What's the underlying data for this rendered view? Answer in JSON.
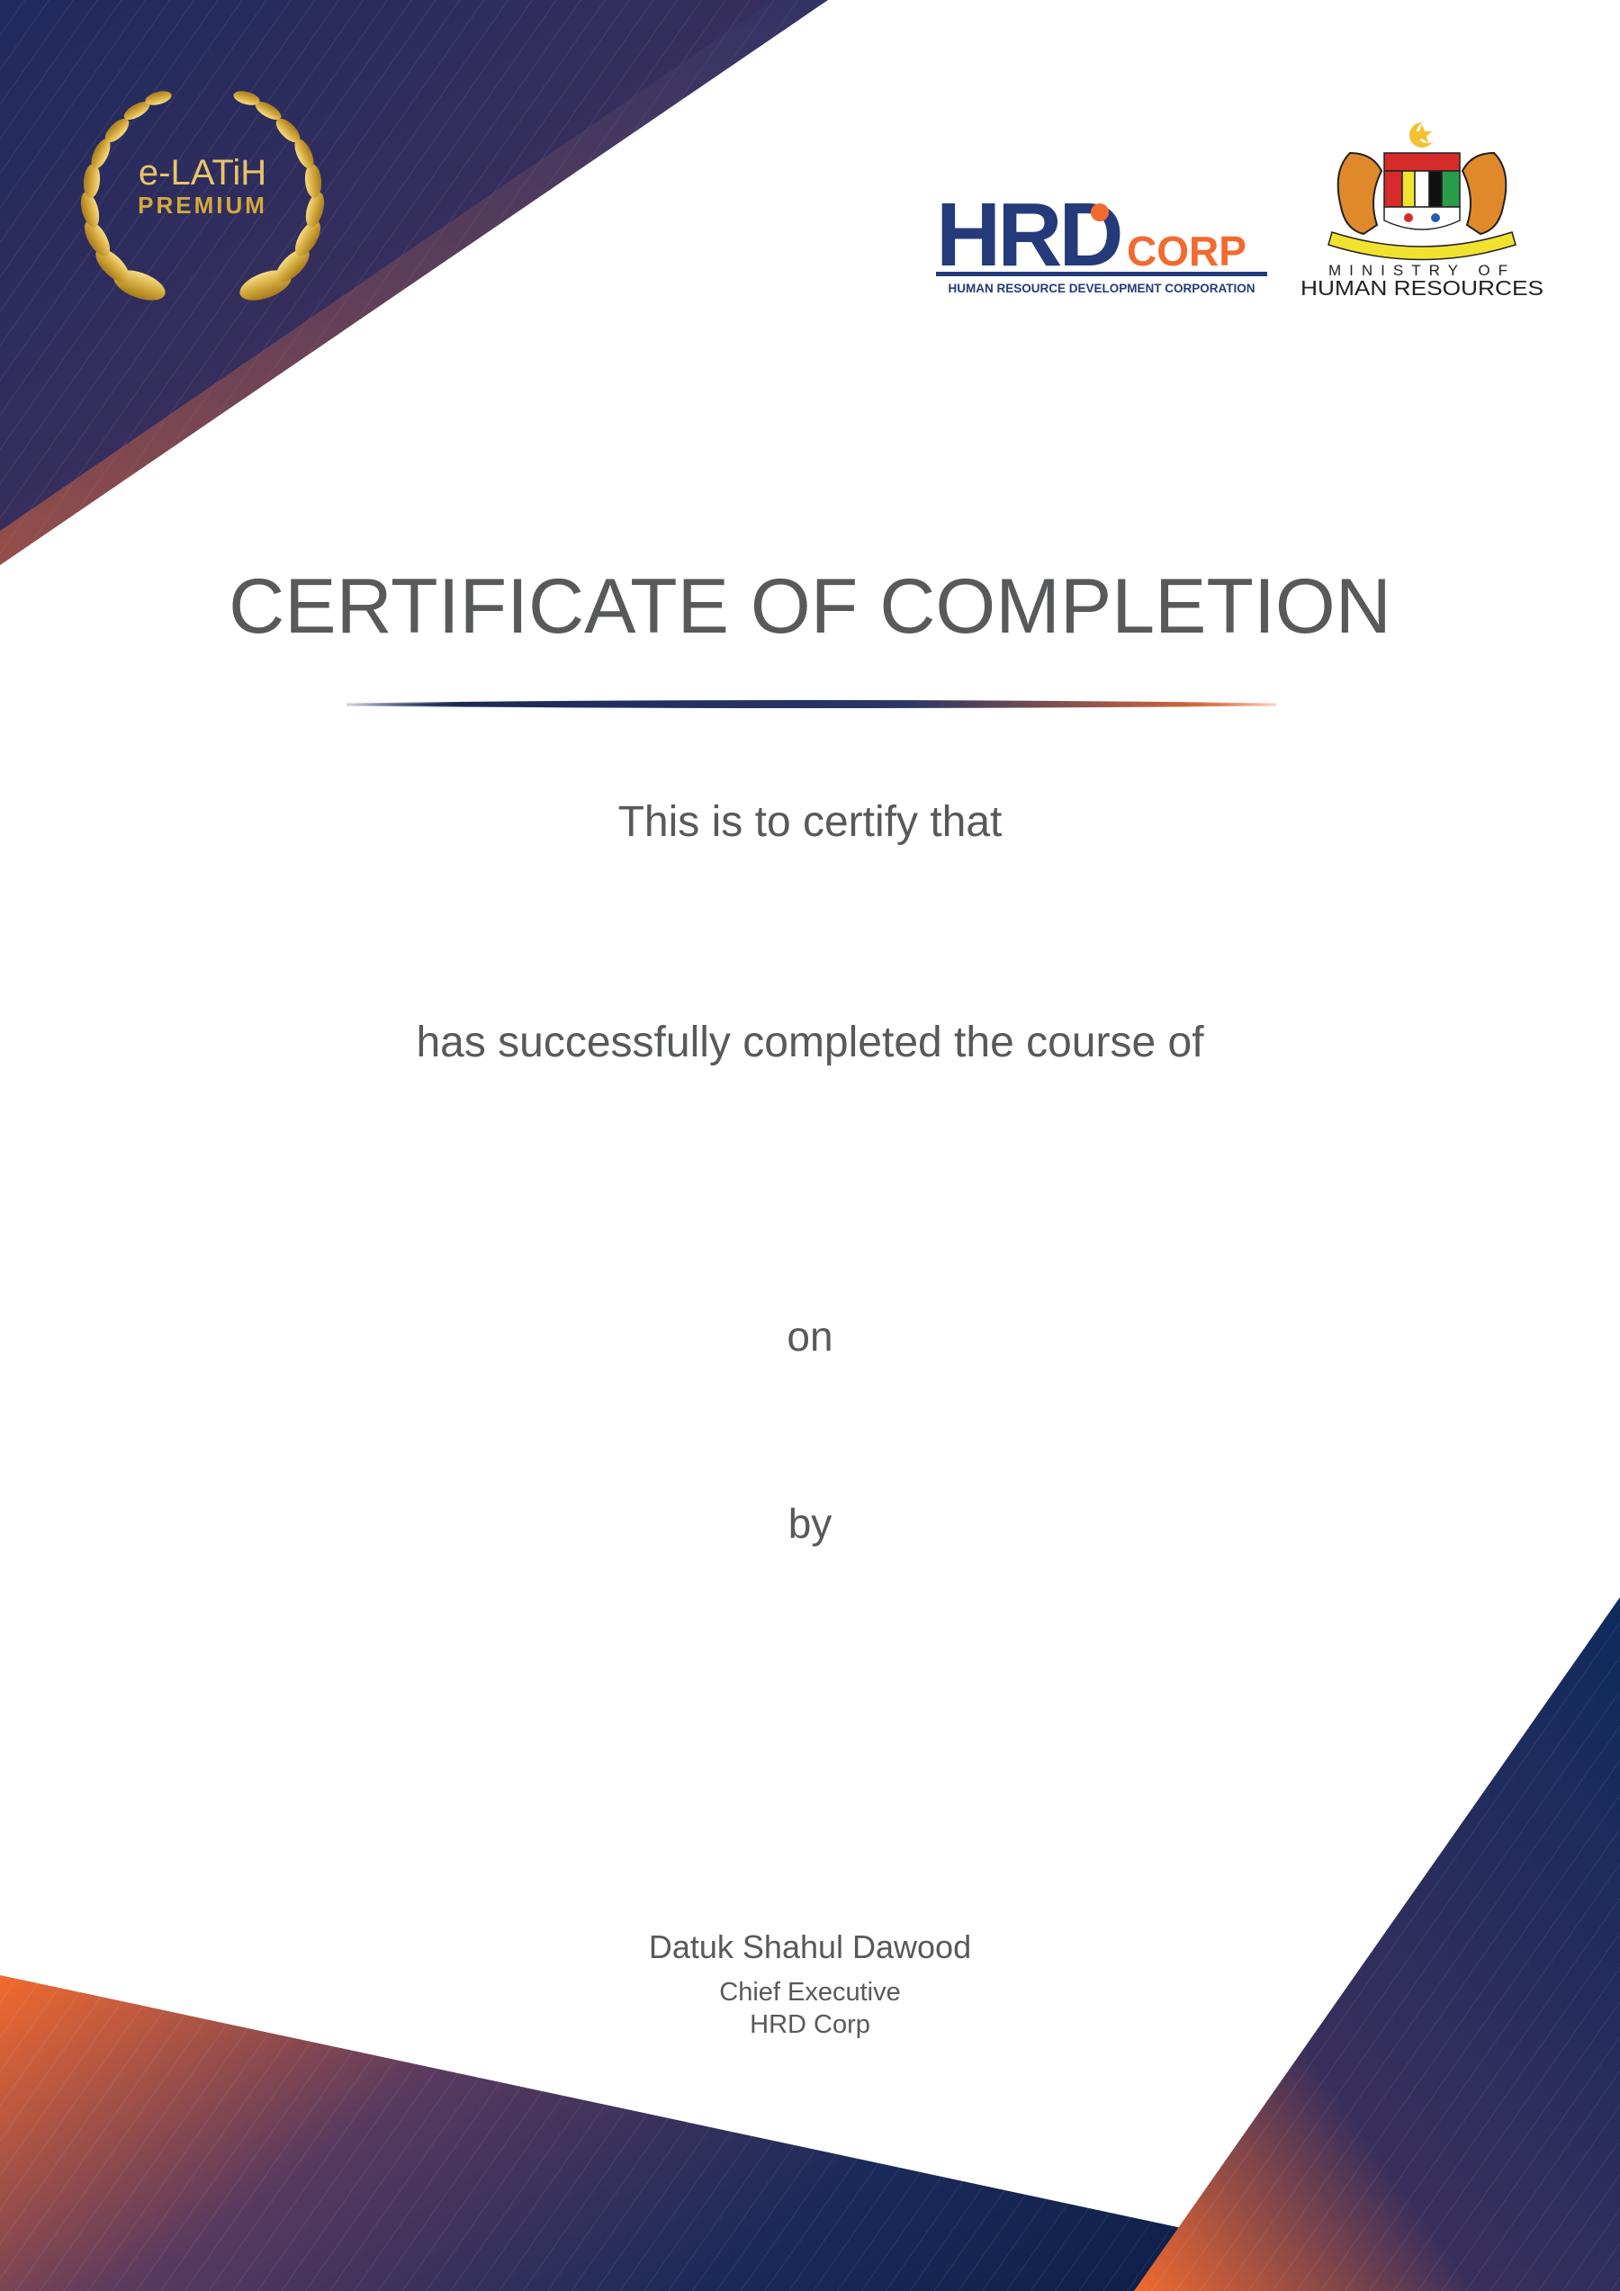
{
  "certificate": {
    "title": "CERTIFICATE OF COMPLETION",
    "certify_line": "This is to certify that",
    "completed_line": "has successfully completed the course of",
    "on_line": "on",
    "by_line": "by"
  },
  "signatory": {
    "name": "Datuk Shahul Dawood",
    "title": "Chief Executive",
    "organization": "HRD Corp"
  },
  "logos": {
    "elatih_top": "e-LATiH",
    "elatih_bottom": "PREMIUM",
    "hrd_main": "HRD",
    "hrd_corp": "CORP",
    "hrd_tagline": "HUMAN RESOURCE DEVELOPMENT CORPORATION",
    "ministry_line1": "MINISTRY OF",
    "ministry_line2": "HUMAN RESOURCES"
  },
  "colors": {
    "navy": "#1c2a5a",
    "orange": "#f26a2e",
    "gold": "#d4a93c",
    "text_gray": "#58595b"
  }
}
